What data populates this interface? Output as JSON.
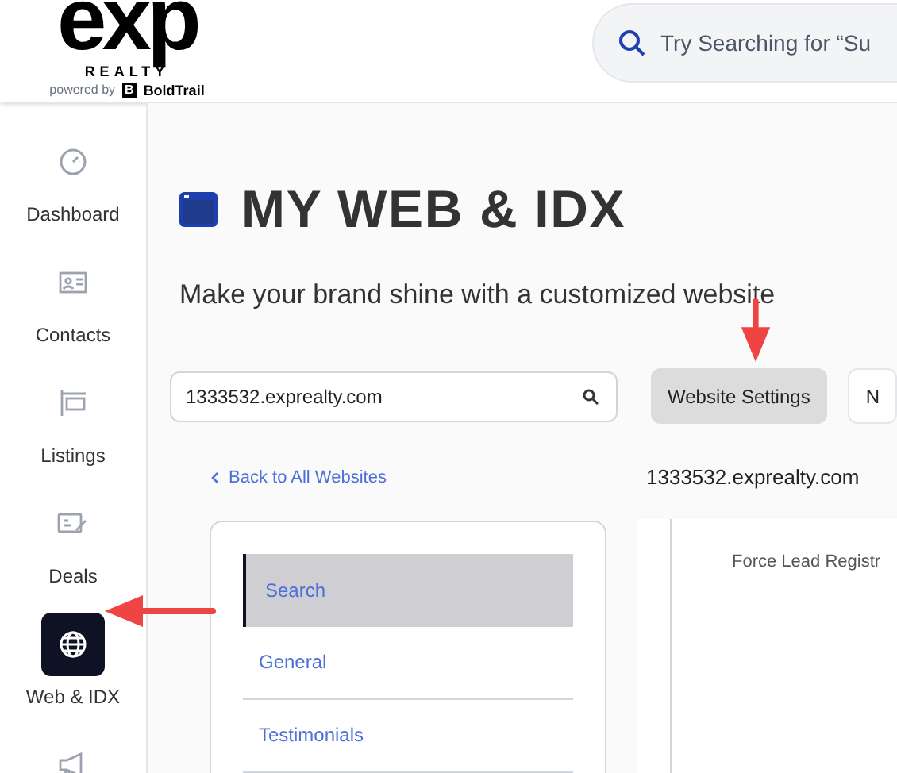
{
  "logo": {
    "wordmark": "exp",
    "subword": "REALTY",
    "powered_by": "powered by",
    "partner_mark": "B",
    "partner": "BoldTrail"
  },
  "header_search": {
    "placeholder": "Try Searching for “Su"
  },
  "sidebar": {
    "items": [
      {
        "label": "Dashboard",
        "kind": "gauge",
        "selected": false
      },
      {
        "label": "Contacts",
        "kind": "card",
        "selected": false
      },
      {
        "label": "Listings",
        "kind": "sign",
        "selected": false
      },
      {
        "label": "Deals",
        "kind": "deal",
        "selected": false
      },
      {
        "label": "Web & IDX",
        "kind": "globe",
        "selected": true
      },
      {
        "kind": "megaphone",
        "selected": false
      }
    ]
  },
  "page": {
    "title": "MY WEB & IDX",
    "subtitle": "Make your brand shine with a customized website"
  },
  "site_search": {
    "value": "1333532.exprealty.com"
  },
  "toolbar_buttons": [
    {
      "label": "Website Settings",
      "selected": true
    },
    {
      "label": "N",
      "selected": false
    }
  ],
  "back_link": "Back to All Websites",
  "site_title": "1333532.exprealty.com",
  "settings_menu": [
    {
      "label": "Search",
      "selected": true
    },
    {
      "label": "General",
      "selected": false
    },
    {
      "label": "Testimonials",
      "selected": false
    }
  ],
  "panel_text": "Force Lead Registr"
}
